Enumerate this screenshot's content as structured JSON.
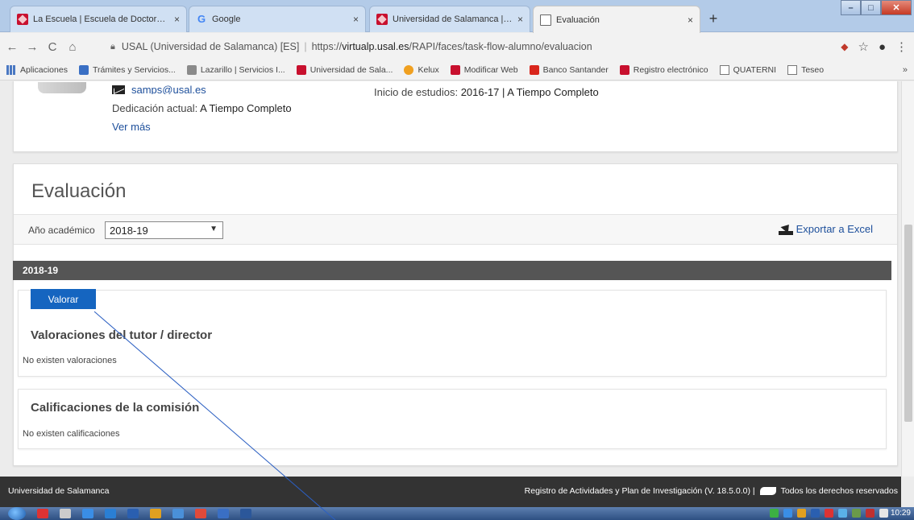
{
  "browser": {
    "tabs": [
      {
        "title": "La Escuela | Escuela de Doctorado",
        "favicon": "usal-icon",
        "close": "×"
      },
      {
        "title": "Google",
        "favicon": "google-icon",
        "close": "×"
      },
      {
        "title": "Universidad de Salamanca | Univ",
        "favicon": "usal-icon",
        "close": "×"
      },
      {
        "title": "Evaluación",
        "favicon": "page-icon",
        "close": "×"
      }
    ],
    "new_tab": "+",
    "address": {
      "site_label": "USAL (Universidad de Salamanca) [ES]",
      "separator": "|",
      "url_prefix": "https://",
      "url_host": "virtualp.usal.es",
      "url_path": "/RAPI/faces/task-flow-alumno/evaluacion"
    },
    "nav": {
      "back": "←",
      "forward": "→",
      "reload": "C",
      "home": "⌂"
    },
    "addr_icons": {
      "extension": "◆",
      "star": "☆",
      "profile": "●",
      "menu": "⋮"
    },
    "bookmarks": [
      {
        "label": "Aplicaciones",
        "icon": "apps-grid-icon"
      },
      {
        "label": "Trámites y Servicios...",
        "icon": "tramites-icon"
      },
      {
        "label": "Lazarillo | Servicios I...",
        "icon": "lazarillo-icon"
      },
      {
        "label": "Universidad de Sala...",
        "icon": "usal-icon"
      },
      {
        "label": "Kelux",
        "icon": "kelux-icon"
      },
      {
        "label": "Modificar Web",
        "icon": "usal-icon"
      },
      {
        "label": "Banco Santander",
        "icon": "santander-icon"
      },
      {
        "label": "Registro electrónico",
        "icon": "usal-icon"
      },
      {
        "label": "QUATERNI",
        "icon": "page-icon"
      },
      {
        "label": "Teseo",
        "icon": "page-icon"
      }
    ],
    "bookmarks_more": "»"
  },
  "profile": {
    "email": "samps@usal.es",
    "dedicacion_label": "Dedicación actual:",
    "dedicacion_value": "A Tiempo Completo",
    "ver_mas": "Ver más",
    "inicio_label": "Inicio de estudios:",
    "inicio_value": "2016-17 | A Tiempo Completo"
  },
  "evaluacion": {
    "title": "Evaluación",
    "year_label": "Año académico",
    "year_selected": "2018-19",
    "export_label": "Exportar a Excel",
    "year_header": "2018-19",
    "valorar_button": "Valorar",
    "tutor_heading": "Valoraciones del tutor / director",
    "tutor_empty": "No existen valoraciones",
    "comision_heading": "Calificaciones de la comisión",
    "comision_empty": "No existen calificaciones"
  },
  "footer": {
    "left": "Universidad de Salamanca",
    "right_app": "Registro de Actividades y Plan de Investigación (V. 18.5.0.0) |",
    "right_rights": "Todos los derechos reservados"
  },
  "taskbar": {
    "clock": "10:29"
  },
  "colors": {
    "accent_blue": "#1565c0",
    "link_blue": "#1d4f9b",
    "header_gray": "#555555",
    "footer_dark": "#333333"
  }
}
